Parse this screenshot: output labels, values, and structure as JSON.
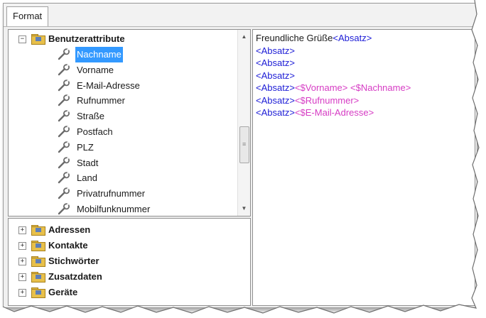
{
  "tabs": [
    {
      "label": "Format"
    }
  ],
  "attribute_tree": {
    "root_label": "Benutzerattribute",
    "root_expander": "−",
    "items": [
      {
        "label": "Nachname",
        "selected": true
      },
      {
        "label": "Vorname"
      },
      {
        "label": "E-Mail-Adresse"
      },
      {
        "label": "Rufnummer"
      },
      {
        "label": "Straße"
      },
      {
        "label": "Postfach"
      },
      {
        "label": "PLZ"
      },
      {
        "label": "Stadt"
      },
      {
        "label": "Land"
      },
      {
        "label": "Privatrufnummer"
      },
      {
        "label": "Mobilfunknummer"
      }
    ],
    "scroll_up": "▲",
    "scroll_down": "▼",
    "scroll_grip": "≡"
  },
  "group_tree": {
    "expander": "+",
    "groups": [
      {
        "label": "Adressen"
      },
      {
        "label": "Kontakte"
      },
      {
        "label": "Stichwörter"
      },
      {
        "label": "Zusatzdaten"
      },
      {
        "label": "Geräte"
      }
    ]
  },
  "editor": {
    "lines": [
      [
        {
          "text": "Freundliche Grüße",
          "kind": "plain"
        },
        {
          "text": "<Absatz>",
          "kind": "tag"
        }
      ],
      [
        {
          "text": "<Absatz>",
          "kind": "tag"
        }
      ],
      [
        {
          "text": "<Absatz>",
          "kind": "tag"
        }
      ],
      [
        {
          "text": "<Absatz>",
          "kind": "tag"
        }
      ],
      [
        {
          "text": "<Absatz>",
          "kind": "tag"
        },
        {
          "text": "<$Vorname>",
          "kind": "field"
        },
        {
          "text": " ",
          "kind": "plain"
        },
        {
          "text": "<$Nachname>",
          "kind": "field"
        }
      ],
      [
        {
          "text": "<Absatz>",
          "kind": "tag"
        },
        {
          "text": "<$Rufnummer>",
          "kind": "field"
        }
      ],
      [
        {
          "text": "<Absatz>",
          "kind": "tag"
        },
        {
          "text": "<$E-Mail-Adresse>",
          "kind": "field"
        }
      ]
    ]
  },
  "colors": {
    "tag": "#1c1cd6",
    "field": "#d63cc4",
    "selection": "#3399ff"
  },
  "icons": {
    "attribute": "wrench-icon",
    "group": "folder-icon",
    "root": "folder-icon"
  }
}
